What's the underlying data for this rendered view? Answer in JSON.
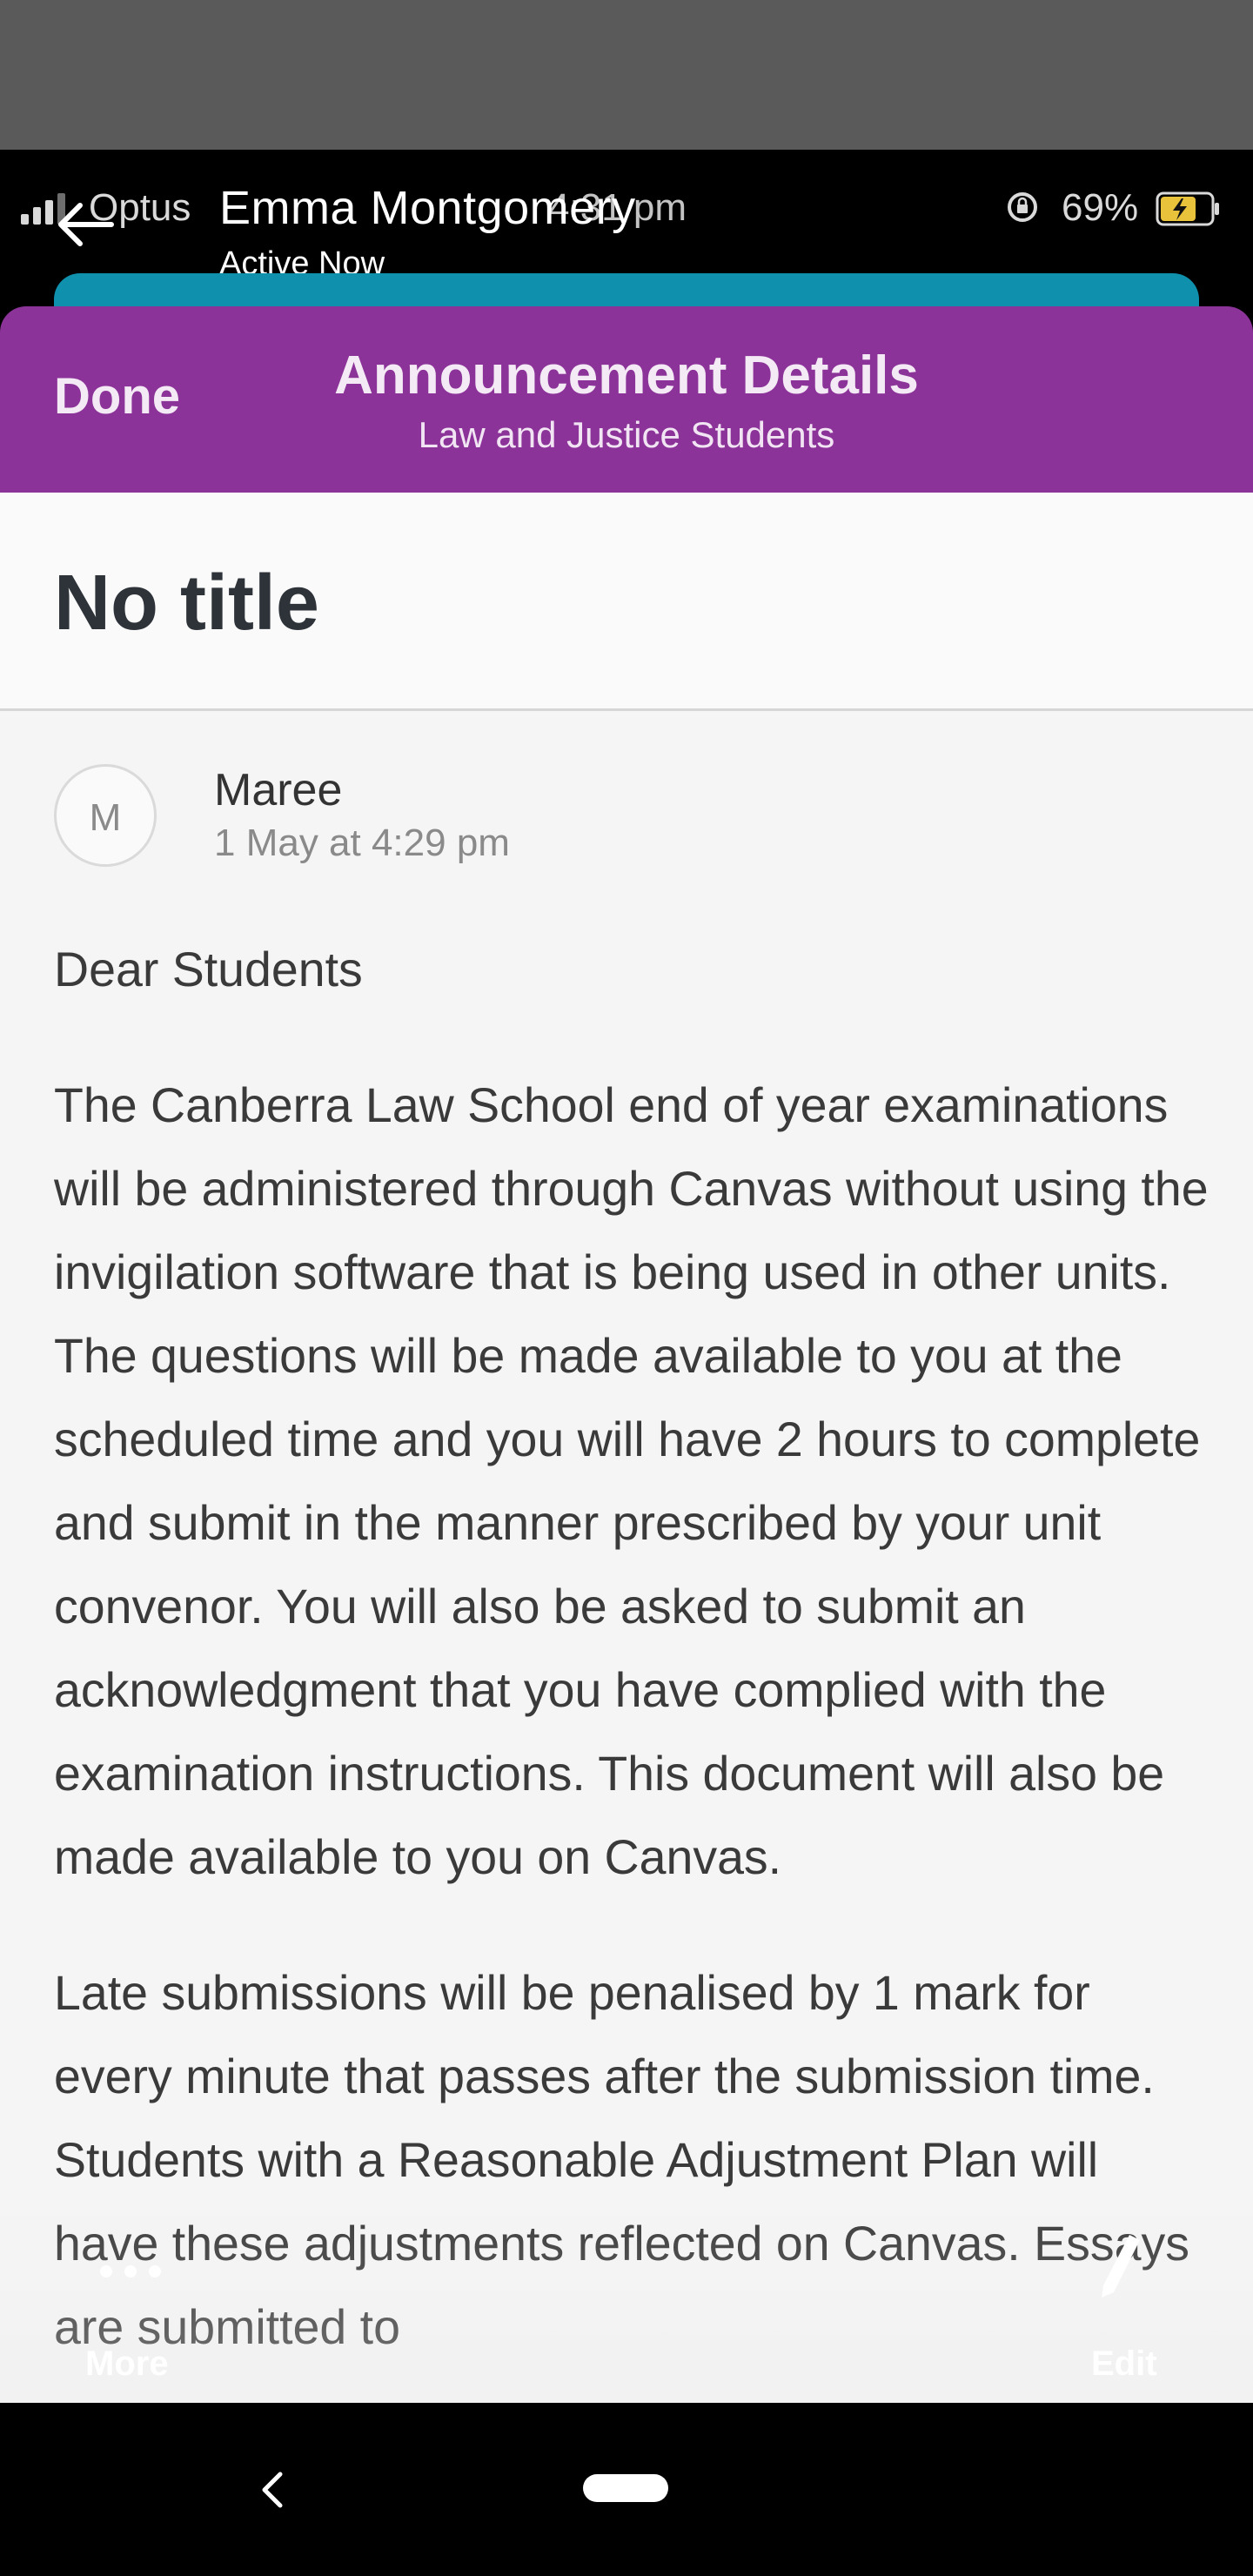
{
  "ios_status": {
    "carrier": "Optus",
    "time": "4:31 pm",
    "battery": "69%"
  },
  "messenger": {
    "contact_name": "Emma Montgomery",
    "status": "Active Now"
  },
  "header": {
    "done_label": "Done",
    "title": "Announcement Details",
    "subtitle": "Law and Justice Students"
  },
  "announcement": {
    "title": "No title",
    "author_initial": "M",
    "author": "Maree",
    "date": "1 May at 4:29 pm",
    "greeting": "Dear Students",
    "paragraph1": "The Canberra Law School end of year examinations will be administered through Canvas without using the invigilation software that is being used in other units. The questions will be made available to you at the scheduled time and you will have 2 hours to complete and submit in the manner prescribed by your unit convenor. You will also be asked to submit an acknowledgment that you have complied with the examination instructions. This document will also be made available to you on Canvas.",
    "paragraph2": "Late submissions will be penalised by 1 mark for every minute that passes after the submission time. Students with a Reasonable Adjustment Plan will have these adjustments reflected on Canvas. Essays are submitted to"
  },
  "bottom_bar": {
    "more_label": "More",
    "edit_label": "Edit"
  },
  "colors": {
    "header_purple": "#8c3399",
    "teal": "#0f90ad"
  }
}
